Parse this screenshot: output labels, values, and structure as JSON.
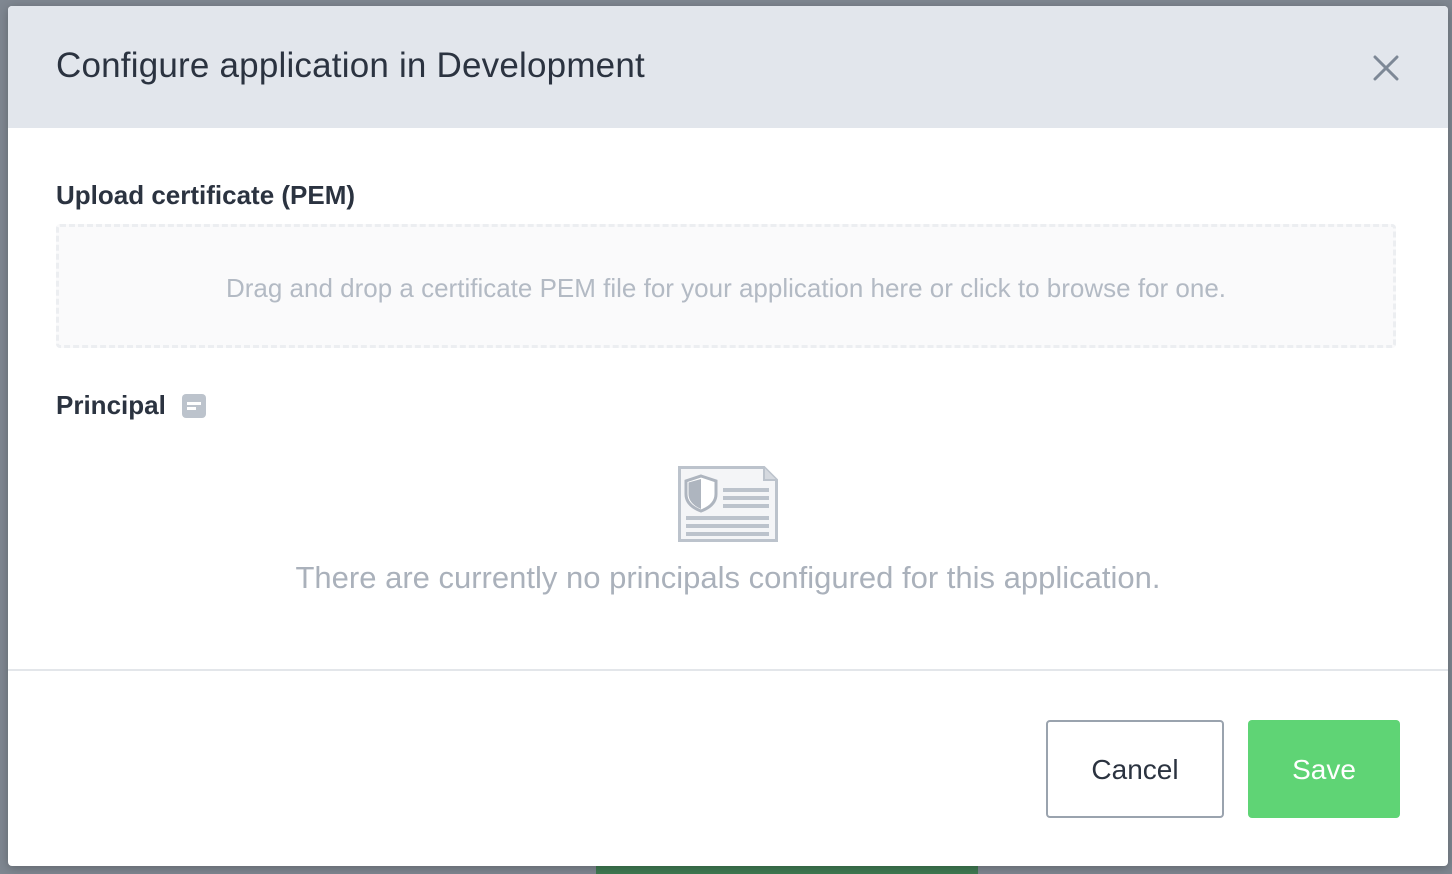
{
  "modal": {
    "title": "Configure application in Development",
    "close_icon": "close-icon"
  },
  "upload": {
    "label": "Upload certificate (PEM)",
    "dropzone_text": "Drag and drop a certificate PEM file for your application here or click to browse for one."
  },
  "principal": {
    "label": "Principal",
    "info_icon": "info-icon",
    "empty_icon": "certificate-shield-icon",
    "empty_text": "There are currently no principals configured for this application."
  },
  "footer": {
    "cancel_label": "Cancel",
    "save_label": "Save"
  },
  "colors": {
    "header_bg": "#e2e6ec",
    "save_green": "#5fd475",
    "text_dark": "#2b3340",
    "text_muted": "#aab1bb"
  }
}
